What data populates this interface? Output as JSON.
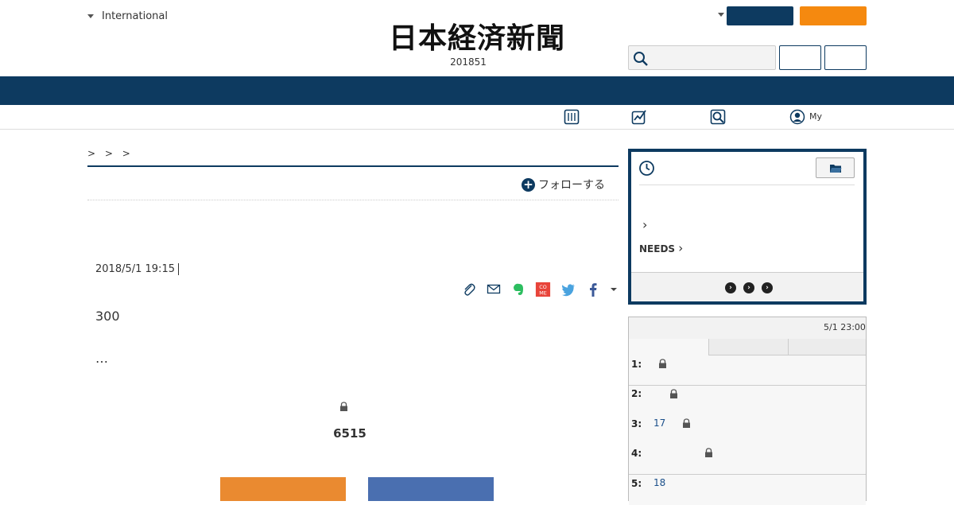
{
  "header": {
    "edition_label": "International",
    "logo_text": "日本経済新聞",
    "logo_date": "201851",
    "search": {
      "placeholder": ""
    },
    "buttons": {
      "navy_label": "",
      "orange_label": "",
      "outline_a_label": "",
      "outline_b_label": ""
    },
    "colors": {
      "navy": "#0d3a60",
      "orange": "#f5890f"
    }
  },
  "subnav": {
    "items": [
      {
        "icon": "newspaper-icon",
        "label": ""
      },
      {
        "icon": "chart-icon",
        "label": ""
      },
      {
        "icon": "search-icon",
        "label": ""
      },
      {
        "icon": "user-icon",
        "label": "My"
      }
    ]
  },
  "article": {
    "breadcrumb": ">    > >",
    "follow_label": "フォローする",
    "dateline": "2018/5/1 19:15",
    "share_icons": [
      "clip-icon",
      "mail-icon",
      "evernote-icon",
      "comemo-icon",
      "twitter-icon",
      "facebook-icon",
      "more-icon"
    ],
    "comemo_text": "CO ME",
    "lead": "300",
    "ellipsis": "…",
    "figure_number": "6515",
    "bar_colors": [
      "#ea8a30",
      "#4a6fb0"
    ]
  },
  "history_panel": {
    "needs_label": "NEEDS",
    "footer_dots": [
      "›",
      "›",
      "›"
    ]
  },
  "ranking": {
    "updated": "5/1 23:00",
    "tabs": [
      "",
      "",
      ""
    ],
    "rows": [
      {
        "rank": "1:",
        "text": "",
        "locked": true
      },
      {
        "rank": "2:",
        "text": "",
        "locked": true
      },
      {
        "rank": "3:",
        "text": "17",
        "locked": true
      },
      {
        "rank": "4:",
        "text": "",
        "locked": true
      },
      {
        "rank": "5:",
        "text": "18",
        "locked": false
      }
    ]
  }
}
